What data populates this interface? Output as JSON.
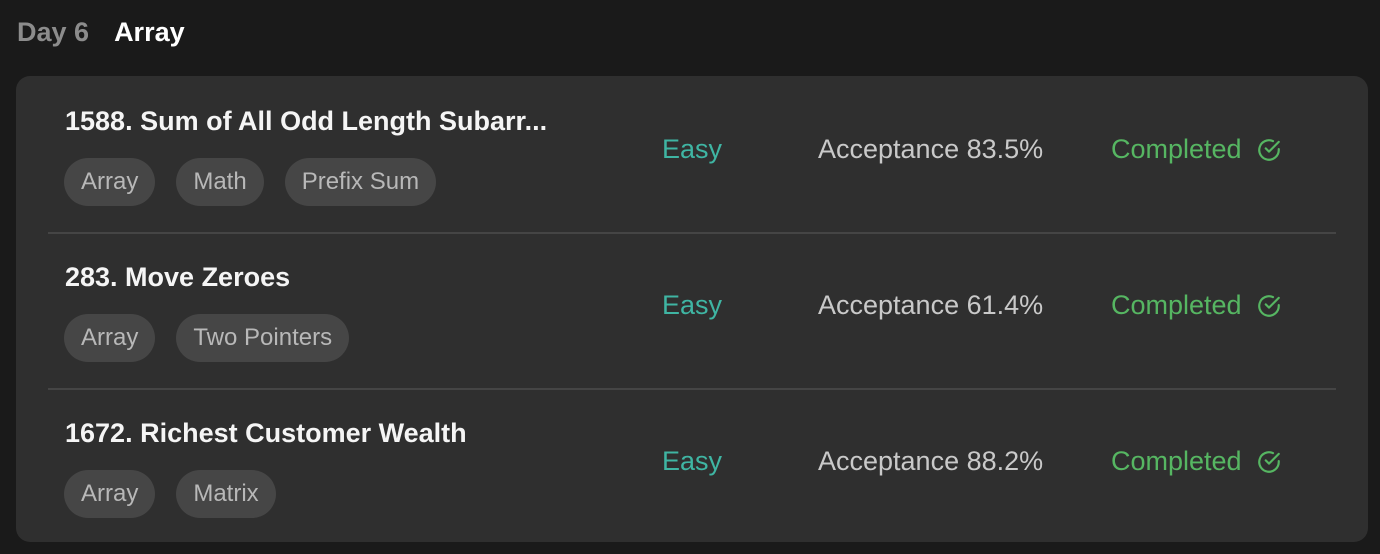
{
  "header": {
    "day": "Day 6",
    "title": "Array"
  },
  "problems": [
    {
      "title": "1588. Sum of All Odd Length Subarr...",
      "tags": [
        "Array",
        "Math",
        "Prefix Sum"
      ],
      "difficulty": "Easy",
      "acceptance": "Acceptance 83.5%",
      "status": "Completed",
      "status_icon": "check-circle-icon"
    },
    {
      "title": "283. Move Zeroes",
      "tags": [
        "Array",
        "Two Pointers"
      ],
      "difficulty": "Easy",
      "acceptance": "Acceptance 61.4%",
      "status": "Completed",
      "status_icon": "check-circle-icon"
    },
    {
      "title": "1672. Richest Customer Wealth",
      "tags": [
        "Array",
        "Matrix"
      ],
      "difficulty": "Easy",
      "acceptance": "Acceptance 88.2%",
      "status": "Completed",
      "status_icon": "check-circle-icon"
    }
  ],
  "colors": {
    "background": "#1a1a1a",
    "card": "#2f2f2f",
    "easy": "#3fb5a3",
    "completed": "#56b662"
  }
}
